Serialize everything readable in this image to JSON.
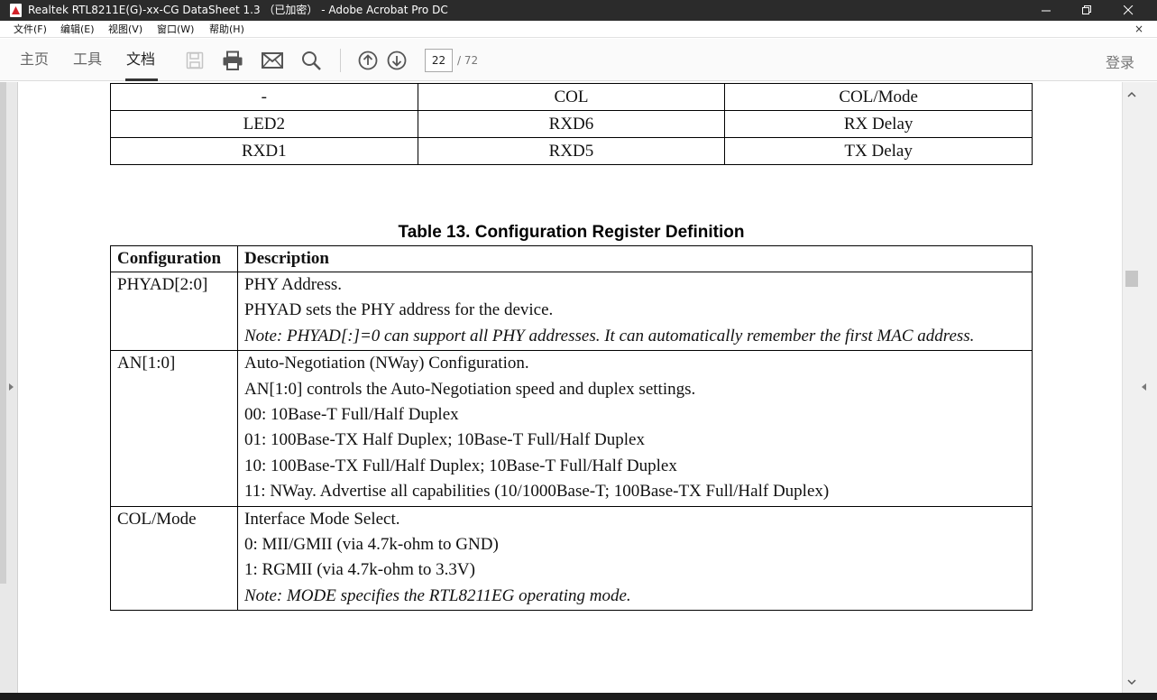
{
  "window": {
    "title": "Realtek RTL8211E(G)-xx-CG DataSheet 1.3 （已加密） - Adobe Acrobat Pro DC",
    "icon": "pdf-app-icon"
  },
  "menu": {
    "items": [
      "文件(F)",
      "编辑(E)",
      "视图(V)",
      "窗口(W)",
      "帮助(H)"
    ],
    "close_doc": "×"
  },
  "toolbar": {
    "tabs": [
      "主页",
      "工具",
      "文档"
    ],
    "active_tab": "文档",
    "icons": [
      "save-icon",
      "print-icon",
      "email-icon",
      "search-icon",
      "previous-page-icon",
      "next-page-icon"
    ],
    "page_current": "22",
    "page_total": "/ 72",
    "login_label": "登录"
  },
  "document": {
    "pin_table": {
      "rows": [
        [
          "-",
          "COL",
          "COL/Mode"
        ],
        [
          "LED2",
          "RXD6",
          "RX Delay"
        ],
        [
          "RXD1",
          "RXD5",
          "TX Delay"
        ]
      ]
    },
    "config_table": {
      "caption": "Table 13. Configuration Register Definition",
      "headers": [
        "Configuration",
        "Description"
      ],
      "rows": [
        {
          "name": "PHYAD[2:0]",
          "lines": [
            "PHY Address.",
            "PHYAD sets the PHY address for the device."
          ],
          "note": "Note: PHYAD[:]=0 can support all PHY addresses. It can automatically remember the first MAC address."
        },
        {
          "name": "AN[1:0]",
          "lines": [
            "Auto-Negotiation (NWay) Configuration.",
            "AN[1:0] controls the Auto-Negotiation speed and duplex settings.",
            "00: 10Base-T Full/Half Duplex",
            "01: 100Base-TX Half Duplex; 10Base-T Full/Half Duplex",
            "10: 100Base-TX Full/Half Duplex; 10Base-T Full/Half Duplex",
            "11: NWay. Advertise all capabilities (10/1000Base-T; 100Base-TX Full/Half Duplex)"
          ]
        },
        {
          "name": "COL/Mode",
          "lines": [
            "Interface Mode Select.",
            "0: MII/GMII (via 4.7k-ohm to GND)",
            "1: RGMII (via 4.7k-ohm to 3.3V)"
          ],
          "note": "Note: MODE specifies the RTL8211EG operating mode."
        }
      ]
    }
  }
}
